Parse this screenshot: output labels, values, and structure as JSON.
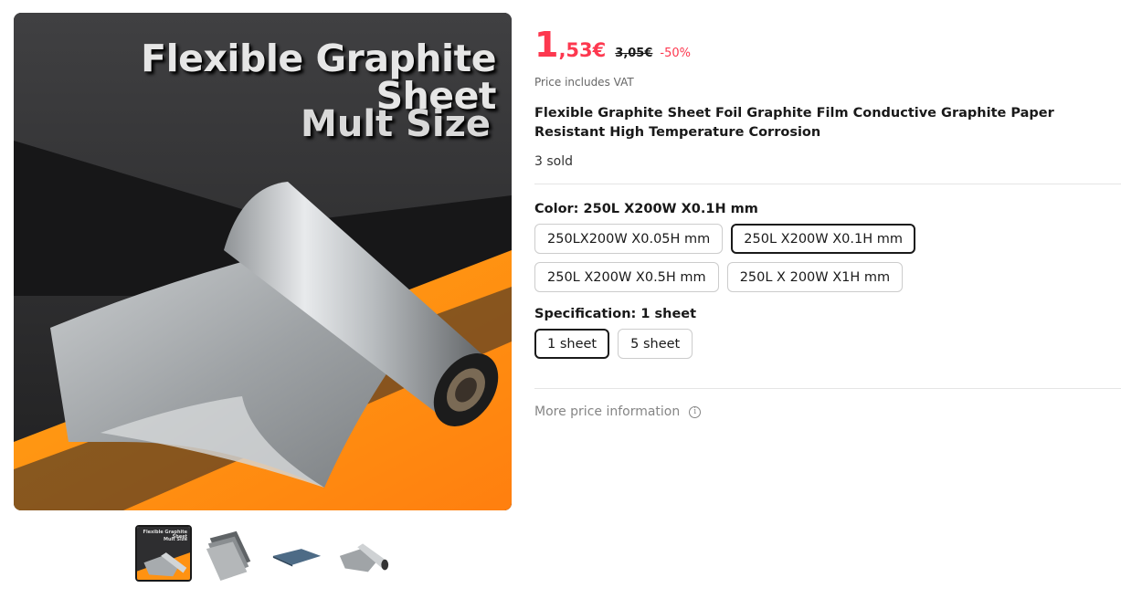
{
  "gallery": {
    "main_image": {
      "title": "Flexible Graphite Sheet",
      "subtitle": "Mult Size"
    },
    "thumbnails": [
      {
        "name": "thumb-flexible-graphite-sheet",
        "caption_title": "Flexible Graphite Sheet",
        "caption_sub": "Mult Size",
        "active": true
      },
      {
        "name": "thumb-stacked-sheets",
        "active": false
      },
      {
        "name": "thumb-single-sheet",
        "active": false
      },
      {
        "name": "thumb-graphite-roll",
        "active": false
      }
    ]
  },
  "price": {
    "integer": "1",
    "decimal": ",53€",
    "original": "3,05€",
    "discount": "-50%",
    "vat_note": "Price includes VAT",
    "accent_color": "#fd384f"
  },
  "product": {
    "title": "Flexible Graphite Sheet Foil Graphite Film Conductive Graphite Paper Resistant High Temperature Corrosion",
    "sold": "3 sold"
  },
  "color": {
    "label": "Color: 250L X200W X0.1H mm",
    "options": [
      {
        "label": "250LX200W X0.05H mm",
        "selected": false
      },
      {
        "label": "250L X200W X0.1H mm",
        "selected": true
      },
      {
        "label": "250L X200W X0.5H mm",
        "selected": false
      },
      {
        "label": "250L X 200W X1H mm",
        "selected": false
      }
    ]
  },
  "specification": {
    "label": "Specification: 1 sheet",
    "options": [
      {
        "label": "1 sheet",
        "selected": true
      },
      {
        "label": "5 sheet",
        "selected": false
      }
    ]
  },
  "more_price": {
    "label": "More price information",
    "icon": "info-icon"
  }
}
